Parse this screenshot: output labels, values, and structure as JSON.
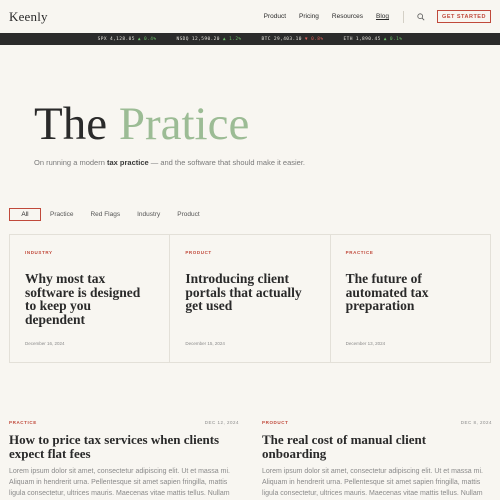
{
  "header": {
    "logo": "Keenly",
    "nav": [
      {
        "label": "Product"
      },
      {
        "label": "Pricing"
      },
      {
        "label": "Resources"
      },
      {
        "label": "Blog"
      }
    ],
    "cta_label": "GET STARTED"
  },
  "ticker": [
    {
      "sym": "SPX",
      "price": "4,128.05",
      "change": "▲ 0.4%",
      "direction": "up"
    },
    {
      "sym": "NSDQ",
      "price": "12,590.20",
      "change": "▲ 1.2%",
      "direction": "up"
    },
    {
      "sym": "BTC",
      "price": "29,403.10",
      "change": "▼ 0.8%",
      "direction": "down"
    },
    {
      "sym": "ETH",
      "price": "1,890.45",
      "change": "▲ 0.1%",
      "direction": "up"
    }
  ],
  "hero": {
    "title_main": "The ",
    "title_accent": "Pratice",
    "subtitle_pre": "On running a modern ",
    "subtitle_bold": "tax practice",
    "subtitle_post": " — and the software that should make it easier."
  },
  "filters": [
    "All",
    "Practice",
    "Red Flags",
    "Industry",
    "Product"
  ],
  "featured": [
    {
      "category": "INDUSTRY",
      "title": "Why most tax software is designed to keep you dependent",
      "date": "December 16, 2024"
    },
    {
      "category": "PRODUCT",
      "title": "Introducing client portals that actually get used",
      "date": "December 15, 2024"
    },
    {
      "category": "PRACTICE",
      "title": "The future of automated tax preparation",
      "date": "December 13, 2024"
    }
  ],
  "articles": [
    {
      "category": "PRACTICE",
      "date": "DEC 12, 2024",
      "title": "How to price tax services when clients expect flat fees",
      "body": "Lorem ipsum dolor sit amet, consectetur adipiscing elit. Ut et massa mi. Aliquam in hendrerit urna. Pellentesque sit amet sapien fringilla, mattis ligula consectetur, ultrices mauris. Maecenas vitae mattis tellus. Nullam"
    },
    {
      "category": "PRODUCT",
      "date": "DEC 8, 2024",
      "title": "The real cost of manual client onboarding",
      "body": "Lorem ipsum dolor sit amet, consectetur adipiscing elit. Ut et massa mi. Aliquam in hendrerit urna. Pellentesque sit amet sapien fringilla, mattis ligula consectetur, ultrices mauris. Maecenas vitae mattis tellus. Nullam"
    }
  ],
  "colors": {
    "accent": "#c0493b",
    "title_accent": "#9cbc95",
    "ticker_bg": "#2b2b2b",
    "up": "#6cbf6a",
    "down": "#e0605a"
  },
  "icons": {
    "search": "search-icon"
  }
}
